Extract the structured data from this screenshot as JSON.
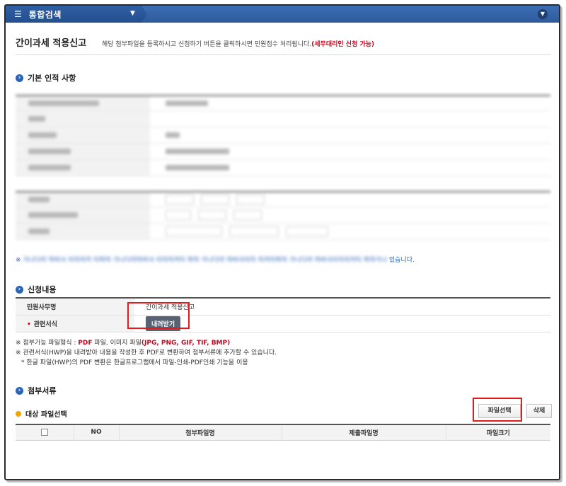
{
  "menu": {
    "title": "통합검색"
  },
  "header": {
    "title": "간이과세 적용신고",
    "description": "해당 첨부파일을 등록하시고 신청하기 버튼을 클릭하시면 민원접수 처리됩니다.",
    "highlight": "(세무대리인 신청 가능)"
  },
  "sections": {
    "basic": "기본 인적 사항",
    "apply": "신청내용",
    "attach": "첨부서류"
  },
  "basic_notice_tail": "있습니다.",
  "apply_table": {
    "row1_label": "민원사무명",
    "row1_value": "간이과세 적용신고",
    "row2_label": "관련서식",
    "download_button": "내려받기"
  },
  "notes": {
    "line1_prefix": "※ 첨부가능 파일형식 : ",
    "line1_pdf": "PDF",
    "line1_mid": " 파일, 이미지 파일",
    "line1_img": "(JPG, PNG, GIF, TIF, BMP)",
    "line2": "※ 관련서식(HWP)을 내려받아 내용을 작성한 후 PDF로 변환하여 첨부서류에 추가할 수 있습니다.",
    "line3": "* 한글 파일(HWP)의 PDF 변환은 한글프로그램에서 파일-인쇄-PDF인쇄 기능을 이용"
  },
  "files": {
    "subheading": "대상 파일선택",
    "select_button": "파일선택",
    "delete_button": "삭제",
    "columns": [
      "NO",
      "첨부파일명",
      "제출파일명",
      "파일크기"
    ]
  }
}
